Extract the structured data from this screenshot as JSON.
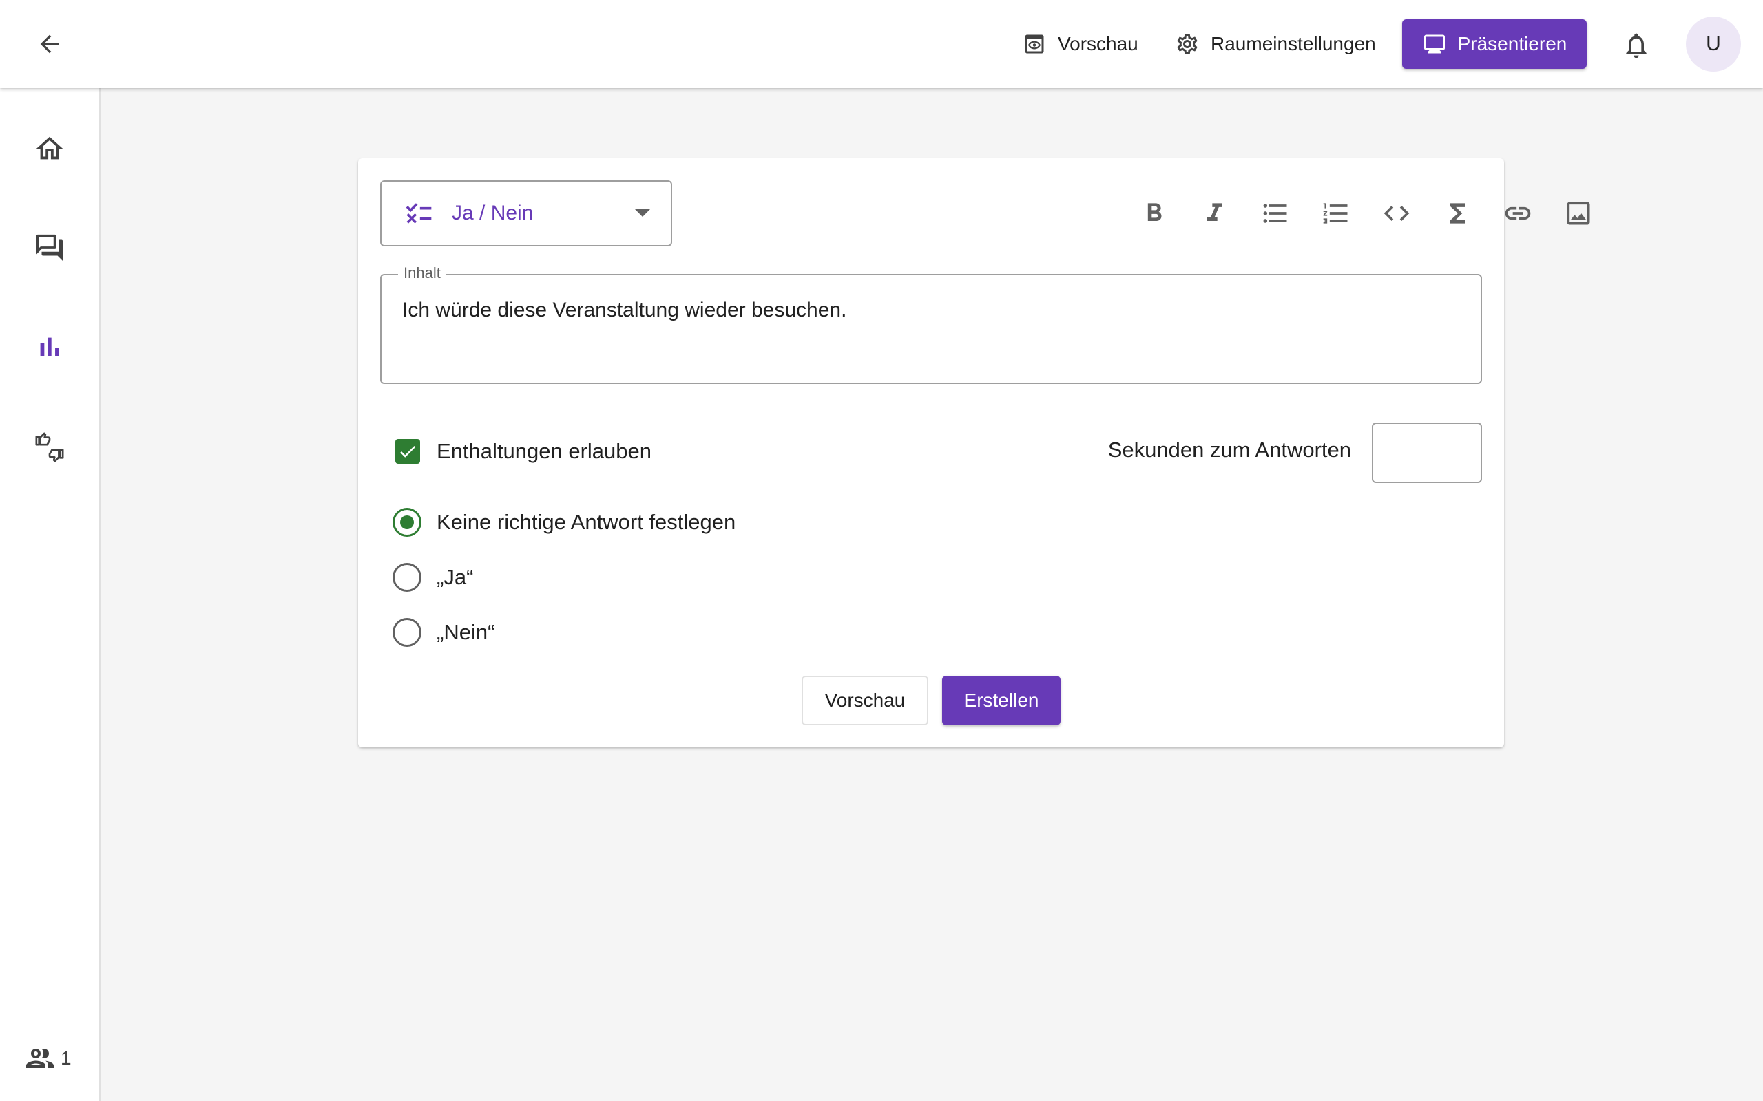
{
  "header": {
    "preview_label": "Vorschau",
    "room_settings_label": "Raumeinstellungen",
    "present_label": "Präsentieren",
    "avatar_initial": "U"
  },
  "sidebar": {
    "items": [
      {
        "icon": "home-icon"
      },
      {
        "icon": "chat-icon"
      },
      {
        "icon": "bar-chart-icon",
        "active": true
      },
      {
        "icon": "feedback-icon"
      }
    ],
    "user_count": "1"
  },
  "editor": {
    "format": {
      "label": "Ja / Nein",
      "icon": "checklist-icon"
    },
    "toolbar": [
      "bold-icon",
      "italic-icon",
      "bullet-list-icon",
      "numbered-list-icon",
      "code-icon",
      "sigma-icon",
      "link-icon",
      "image-icon"
    ],
    "content_label": "Inhalt",
    "content_value": "Ich würde diese Veranstaltung wieder besuchen.",
    "abstentions_label": "Enthaltungen erlauben",
    "abstentions_checked": true,
    "seconds_label": "Sekunden zum Antworten",
    "seconds_value": "",
    "options": [
      {
        "label": "Keine richtige Antwort festlegen",
        "checked": true
      },
      {
        "label": "„Ja“",
        "checked": false
      },
      {
        "label": "„Nein“",
        "checked": false
      }
    ],
    "preview_button": "Vorschau",
    "create_button": "Erstellen"
  },
  "colors": {
    "primary": "#673ab7",
    "success": "#2e7d32",
    "background": "#f5f5f5"
  }
}
